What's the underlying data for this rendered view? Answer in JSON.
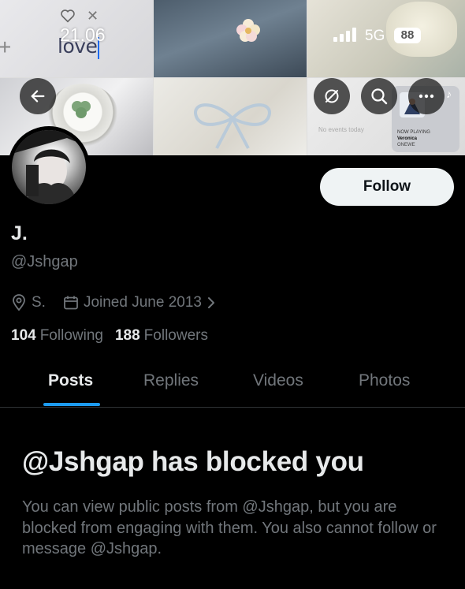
{
  "status_bar": {
    "time": "21.06",
    "network": "5G",
    "battery": "88"
  },
  "header": {
    "image_text": "love",
    "widget_text": "No events today",
    "now_playing": {
      "label": "NOW PLAYING",
      "title": "Veronica",
      "artist": "ONEWE"
    }
  },
  "icons": {
    "back": "arrow-left-icon",
    "sync": "sync-off-icon",
    "search": "search-icon",
    "more": "more-icon",
    "location": "location-pin-icon",
    "calendar": "calendar-icon",
    "chevron": "chevron-right-icon"
  },
  "profile": {
    "display_name": "J.",
    "handle": "@Jshgap",
    "location": "S.",
    "joined": "Joined June 2013",
    "following_count": "104",
    "following_label": "Following",
    "followers_count": "188",
    "followers_label": "Followers",
    "follow_button": "Follow"
  },
  "tabs": [
    {
      "label": "Posts",
      "active": true
    },
    {
      "label": "Replies",
      "active": false
    },
    {
      "label": "Videos",
      "active": false
    },
    {
      "label": "Photos",
      "active": false
    }
  ],
  "blocked": {
    "title": "@Jshgap has blocked you",
    "body": "You can view public posts from @Jshgap, but you are blocked from engaging with them. You also cannot follow or message @Jshgap."
  },
  "colors": {
    "background": "#000000",
    "text_primary": "#e7e9ea",
    "text_secondary": "#71767b",
    "accent": "#1d9bf0",
    "follow_bg": "#eff3f4"
  }
}
